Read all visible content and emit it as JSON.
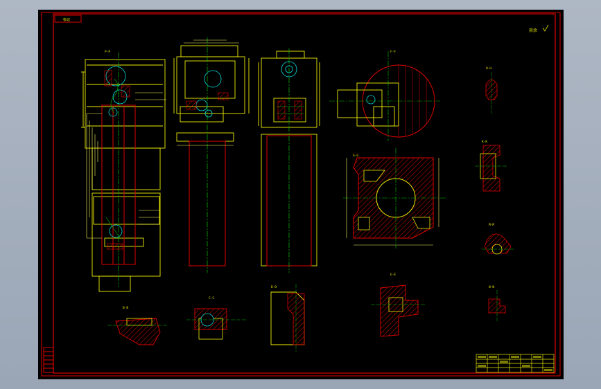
{
  "drawing": {
    "stamp_text": "标记",
    "roughness_note": "其余",
    "section_labels": [
      "B-B",
      "C-C",
      "D-D",
      "E-E",
      "F-F",
      "G-G",
      "H-H",
      "K-K",
      "M-M",
      "N-N",
      "P-P"
    ],
    "colors": {
      "frame": "#e00000",
      "outline": "#f0f000",
      "centerline": "#00c000",
      "hatch": "#e00000",
      "dimension": "#ffff66",
      "accent": "#00e0e0",
      "background": "#000000"
    }
  },
  "title_block": {
    "rows": 6,
    "cols": 7
  }
}
